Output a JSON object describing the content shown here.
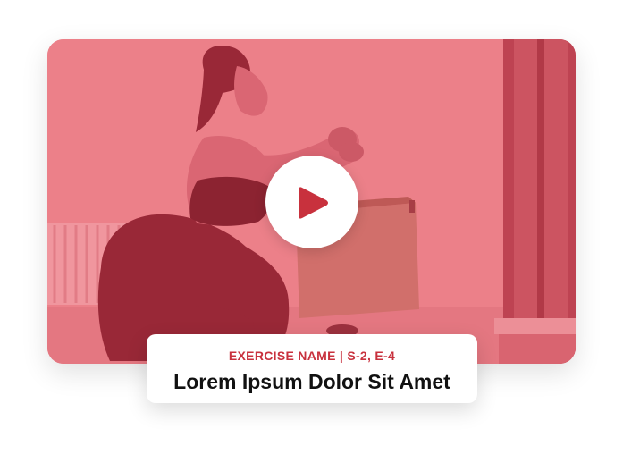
{
  "video": {
    "play_icon": "play-icon",
    "overlay_color": "#e9838d"
  },
  "caption": {
    "meta": "EXERCISE NAME | S-2, E-4",
    "title": "Lorem Ipsum Dolor Sit Amet"
  },
  "colors": {
    "accent": "#c8313d",
    "title": "#111111",
    "card_background": "#ffffff"
  }
}
